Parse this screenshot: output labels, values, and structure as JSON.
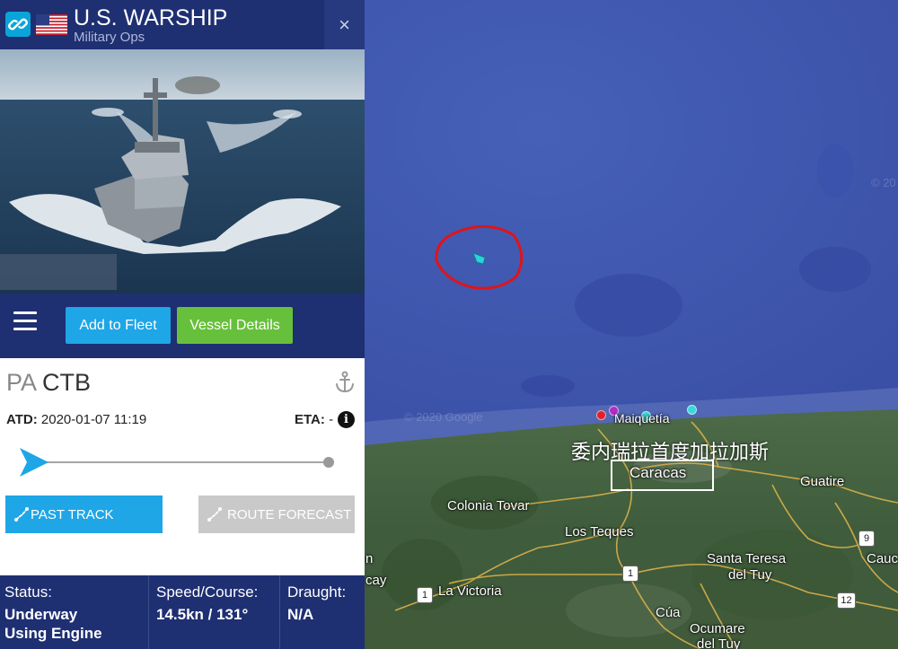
{
  "header": {
    "title": "U.S. WARSHIP",
    "subtitle": "Military Ops",
    "close_label": "×"
  },
  "actions": {
    "add_to_fleet": "Add to Fleet",
    "vessel_details": "Vessel Details"
  },
  "vessel": {
    "flag_code": "PA",
    "name": "CTB",
    "atd_label": "ATD:",
    "atd_value": "2020-01-07 11:19",
    "eta_label": "ETA:",
    "eta_value": "-",
    "past_track": "PAST TRACK",
    "route_forecast": "ROUTE FORECAST"
  },
  "stats": {
    "status_label": "Status:",
    "status_value_line1": "Underway",
    "status_value_line2": "Using Engine",
    "speed_label": "Speed/Course:",
    "speed_value": "14.5kn / 131°",
    "draught_label": "Draught:",
    "draught_value": "N/A"
  },
  "map": {
    "annotation_text": "委内瑞拉首度加拉加斯",
    "watermark": "© 2020 Google",
    "watermark_edge": "© 20",
    "labels": {
      "maiquetia": "Maiquetía",
      "caracas": "Caracas",
      "guatire": "Guatire",
      "colonia_tovar": "Colonia Tovar",
      "los_teques": "Los Teques",
      "santa_teresa_1": "Santa Teresa",
      "santa_teresa_2": "del Tuy",
      "la_victoria": "La Victoria",
      "cua": "Cúa",
      "ocumare_1": "Ocumare",
      "ocumare_2": "del Tuy",
      "caucagua_partial": "Cauc",
      "maracay_partial": "cay",
      "edge_n": "n"
    },
    "road_shields": [
      "1",
      "1",
      "9",
      "12"
    ]
  },
  "colors": {
    "header_navy": "#1e2f72",
    "add_fleet_blue": "#1ea6e6",
    "vessel_details_green": "#67c03b",
    "route_forecast_gray": "#c9c9c9",
    "sea": "#3a4fa3",
    "annotation_red": "#e0141a"
  }
}
